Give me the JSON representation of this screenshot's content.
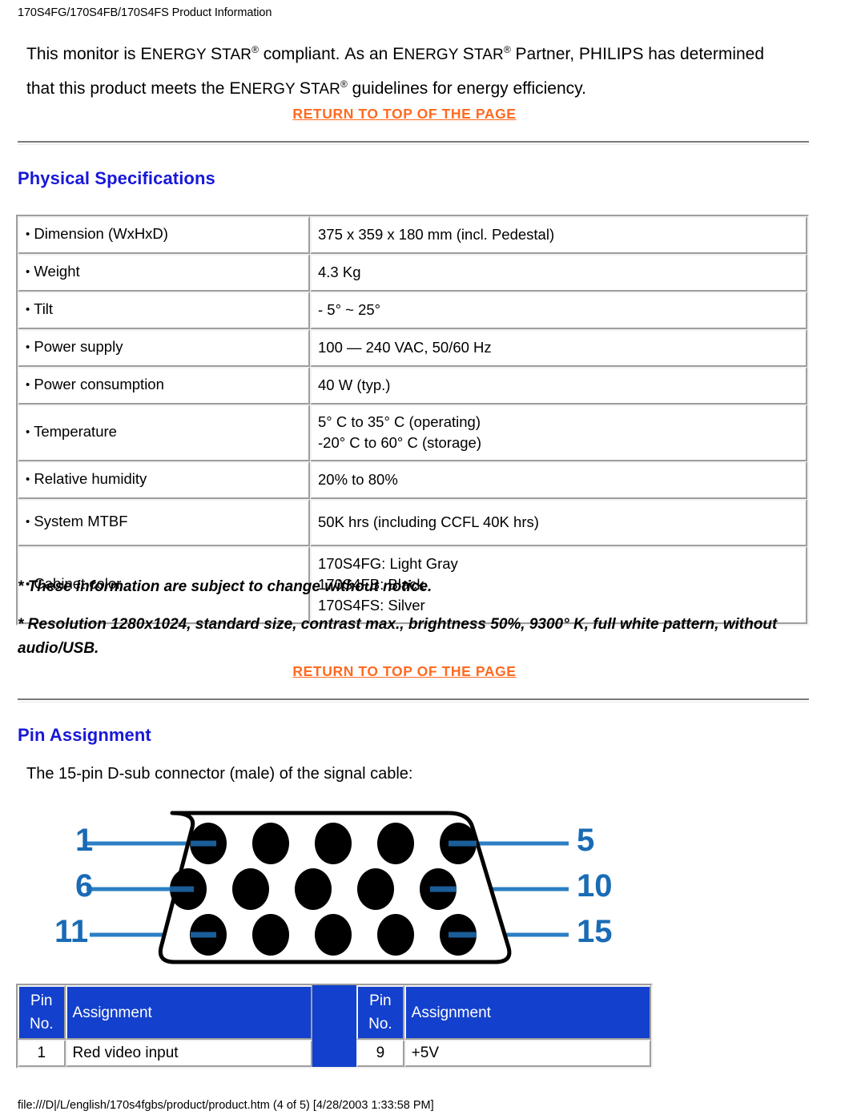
{
  "page": {
    "title": "170S4FG/170S4FB/170S4FS Product Information",
    "footer": "file:///D|/L/english/170s4fgbs/product/product.htm (4 of 5) [4/28/2003 1:33:58 PM]"
  },
  "colors": {
    "heading_blue": "#1818d8",
    "link_orange": "#ff6a21",
    "table_header_blue": "#1340cc",
    "pin_label_blue": "#1a6bb5"
  },
  "intro": {
    "p1_a": "This monitor is ",
    "p1_energy": "E",
    "p1_energy_rest": "NERGY ",
    "p1_star": "S",
    "p1_star_rest": "TAR",
    "p1_reg": "®",
    "p1_b": " compliant. ",
    "p1_c": "A",
    "p1_c_rest": "s an ",
    "p1_energy2": "E",
    "p1_energy2_rest": "NERGY ",
    "p1_star2": "S",
    "p1_star2_rest": "TAR",
    "p1_reg2": "®",
    "p1_d": " Partner, PHILIPS has determined that this product meets the ",
    "p1_energy3": "E",
    "p1_energy3_rest": "NERGY ",
    "p1_star3": "S",
    "p1_star3_rest": "TAR",
    "p1_reg3": "®",
    "p1_e": " guidelines for energy efficiency."
  },
  "links": {
    "return_top_1": "RETURN TO TOP OF THE PAGE",
    "return_top_2": "RETURN TO TOP OF THE PAGE"
  },
  "physical": {
    "heading": "Physical Specifications",
    "rows": [
      {
        "label": "Dimension (WxHxD)",
        "value": "375 x 359 x 180 mm (incl. Pedestal)"
      },
      {
        "label": "Weight",
        "value": "4.3 Kg"
      },
      {
        "label": "Tilt",
        "value": "- 5° ~ 25°"
      },
      {
        "label": "Power supply",
        "value": "100 — 240 VAC, 50/60 Hz"
      },
      {
        "label": "Power consumption",
        "value": "40 W (typ.)"
      },
      {
        "label": "Temperature",
        "value": "5° C to 35° C (operating)\n-20° C to 60° C (storage)"
      },
      {
        "label": "Relative humidity",
        "value": "20% to 80%"
      },
      {
        "label": "System MTBF",
        "value": "50K hrs (including CCFL 40K hrs)"
      },
      {
        "label": "Cabinet color",
        "value": "170S4FG: Light Gray\n170S4FB: Black\n170S4FS: Silver"
      }
    ],
    "note1": "* These information are subject to change without notice.",
    "note2": "* Resolution 1280x1024, standard size, contrast max., brightness 50%, 9300° K, full white pattern, without audio/USB."
  },
  "pin_assignment": {
    "heading": "Pin Assignment",
    "description": "The 15-pin D-sub connector (male) of the signal cable:",
    "connector_labels": {
      "left_top": "1",
      "left_mid": "6",
      "left_bottom": "11",
      "right_top": "5",
      "right_mid": "10",
      "right_bottom": "15"
    },
    "headers": {
      "pin_no": "Pin\nNo.",
      "assignment": "Assignment"
    },
    "rows_left": [
      {
        "no": "1",
        "assignment": "Red video input"
      }
    ],
    "rows_right": [
      {
        "no": "9",
        "assignment": "+5V"
      }
    ]
  }
}
